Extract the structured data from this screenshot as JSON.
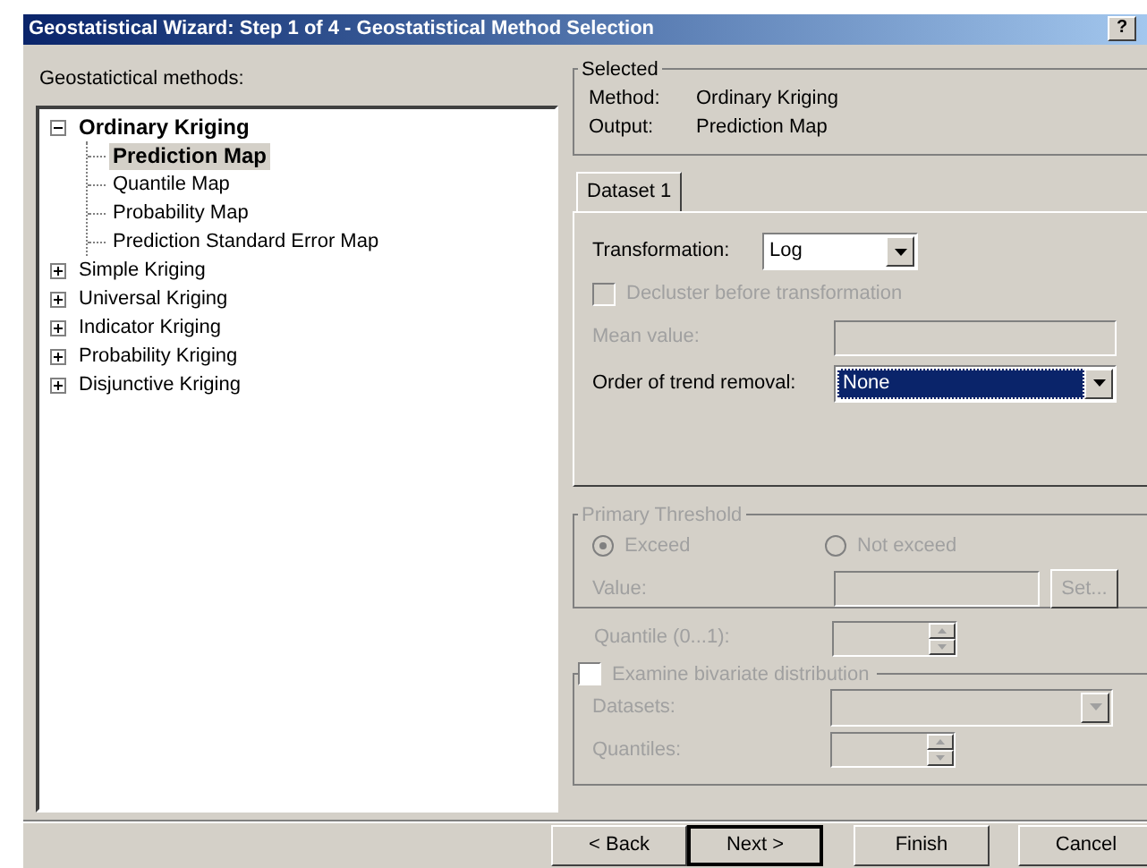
{
  "window": {
    "title": "Geostatistical Wizard: Step 1 of 4 - Geostatistical Method Selection",
    "title_buttons": [
      "?"
    ]
  },
  "methods": {
    "label": "Geostatictical methods:",
    "tree": [
      {
        "label": "Ordinary Kriging",
        "expanded": true,
        "selected": false,
        "children": [
          {
            "label": "Prediction Map",
            "selected": true
          },
          {
            "label": "Quantile Map",
            "selected": false
          },
          {
            "label": "Probability Map",
            "selected": false
          },
          {
            "label": "Prediction Standard Error Map",
            "selected": false
          }
        ]
      },
      {
        "label": "Simple Kriging",
        "expanded": false,
        "selected": false
      },
      {
        "label": "Universal Kriging",
        "expanded": false,
        "selected": false
      },
      {
        "label": "Indicator Kriging",
        "expanded": false,
        "selected": false
      },
      {
        "label": "Probability Kriging",
        "expanded": false,
        "selected": false
      },
      {
        "label": "Disjunctive Kriging",
        "expanded": false,
        "selected": false
      }
    ]
  },
  "selected_group": {
    "title": "Selected",
    "rows": [
      {
        "label": "Method:",
        "value": "Ordinary Kriging"
      },
      {
        "label": "Output:",
        "value": "Prediction Map"
      }
    ]
  },
  "tabs": [
    {
      "label": "Dataset 1",
      "selected": true
    }
  ],
  "dataset": {
    "transformation": {
      "label": "Transformation:",
      "value": "Log",
      "disabled": false
    },
    "decluster": {
      "label": "Decluster before transformation",
      "checked": false,
      "disabled": true
    },
    "mean_value": {
      "label": "Mean value:",
      "disabled": true
    },
    "trend_removal": {
      "label": "Order of trend removal:",
      "value": "None",
      "disabled": false,
      "focused": true
    }
  },
  "threshold": {
    "title": "Primary Threshold",
    "disabled": true,
    "radios": [
      {
        "label": "Exceed",
        "selected": true
      },
      {
        "label": "Not exceed",
        "selected": false
      }
    ],
    "value_label": "Value:",
    "set_button": "Set..."
  },
  "quantile": {
    "label": "Quantile (0...1):",
    "disabled": true
  },
  "bivariate": {
    "label": "Examine bivariate distribution",
    "checked": false,
    "datasets_label": "Datasets:",
    "quantiles_label": "Quantiles:"
  },
  "buttons": [
    {
      "label": "< Back",
      "default": false
    },
    {
      "label": "Next >",
      "default": true
    },
    {
      "label": "Finish",
      "default": false
    },
    {
      "label": "Cancel",
      "default": false
    }
  ]
}
